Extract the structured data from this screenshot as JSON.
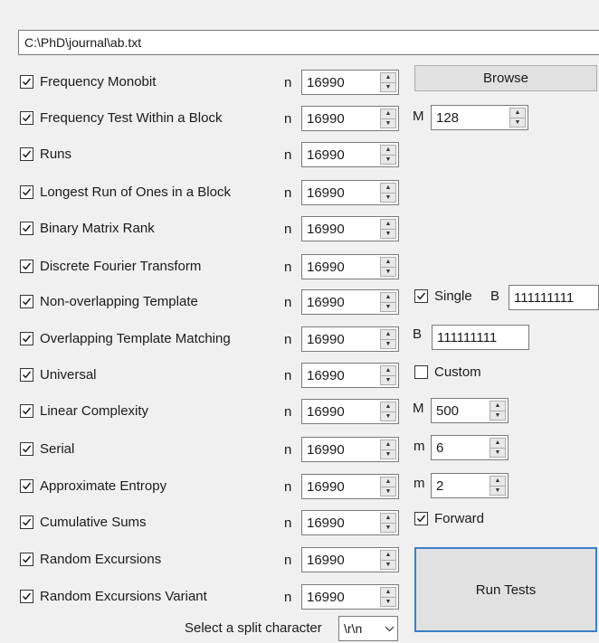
{
  "file_path": "C:\\PhD\\journal\\ab.txt",
  "n_label": "n",
  "tests": [
    {
      "label": "Frequency Monobit",
      "checked": true,
      "n": "16990"
    },
    {
      "label": "Frequency Test Within a Block",
      "checked": true,
      "n": "16990"
    },
    {
      "label": "Runs",
      "checked": true,
      "n": "16990"
    },
    {
      "label": "Longest Run of Ones in a Block",
      "checked": true,
      "n": "16990"
    },
    {
      "label": "Binary Matrix Rank",
      "checked": true,
      "n": "16990"
    },
    {
      "label": "Discrete Fourier Transform",
      "checked": true,
      "n": "16990"
    },
    {
      "label": "Non-overlapping Template",
      "checked": true,
      "n": "16990"
    },
    {
      "label": "Overlapping Template Matching",
      "checked": true,
      "n": "16990"
    },
    {
      "label": "Universal",
      "checked": true,
      "n": "16990"
    },
    {
      "label": "Linear Complexity",
      "checked": true,
      "n": "16990"
    },
    {
      "label": "Serial",
      "checked": true,
      "n": "16990"
    },
    {
      "label": "Approximate Entropy",
      "checked": true,
      "n": "16990"
    },
    {
      "label": "Cumulative Sums",
      "checked": true,
      "n": "16990"
    },
    {
      "label": "Random Excursions",
      "checked": true,
      "n": "16990"
    },
    {
      "label": "Random Excursions Variant",
      "checked": true,
      "n": "16990"
    }
  ],
  "browse_label": "Browse",
  "block_M": {
    "letter": "M",
    "value": "128"
  },
  "non_overlap": {
    "single_label": "Single",
    "single_checked": true,
    "b_letter": "B",
    "b_value": "111111111"
  },
  "overlap": {
    "b_letter": "B",
    "b_value": "111111111"
  },
  "universal": {
    "custom_label": "Custom",
    "custom_checked": false
  },
  "linear_M": {
    "letter": "M",
    "value": "500"
  },
  "serial_m": {
    "letter": "m",
    "value": "6"
  },
  "approx_m": {
    "letter": "m",
    "value": "2"
  },
  "cusum": {
    "forward_label": "Forward",
    "forward_checked": true
  },
  "run_tests_label": "Run Tests",
  "split": {
    "label": "Select a split character",
    "value": "\\r\\n"
  },
  "icons": {
    "check": "check-icon",
    "spin_up": "spin-up-icon",
    "spin_down": "spin-down-icon",
    "dropdown": "chevron-down-icon"
  }
}
